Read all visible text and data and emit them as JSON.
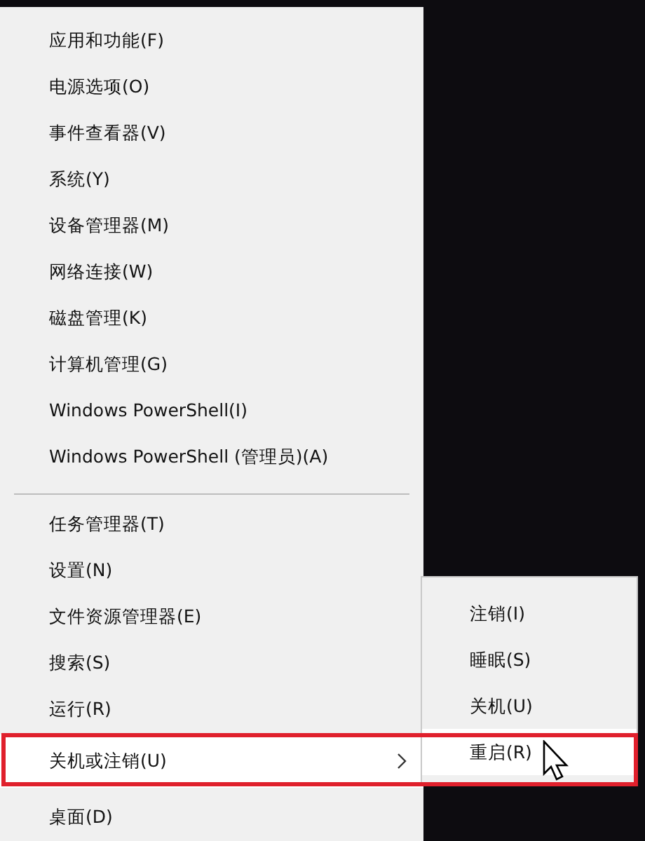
{
  "menu": {
    "groups": [
      {
        "items": [
          {
            "label": "应用和功能(F)",
            "selected": false,
            "outlined": false,
            "has_submenu": false
          },
          {
            "label": "电源选项(O)",
            "selected": false,
            "outlined": false,
            "has_submenu": false
          },
          {
            "label": "事件查看器(V)",
            "selected": false,
            "outlined": false,
            "has_submenu": false
          },
          {
            "label": "系统(Y)",
            "selected": false,
            "outlined": false,
            "has_submenu": false
          },
          {
            "label": "设备管理器(M)",
            "selected": false,
            "outlined": false,
            "has_submenu": false
          },
          {
            "label": "网络连接(W)",
            "selected": false,
            "outlined": false,
            "has_submenu": false
          },
          {
            "label": "磁盘管理(K)",
            "selected": false,
            "outlined": false,
            "has_submenu": false
          },
          {
            "label": "计算机管理(G)",
            "selected": false,
            "outlined": false,
            "has_submenu": false
          },
          {
            "label": "Windows PowerShell(I)",
            "selected": false,
            "outlined": false,
            "has_submenu": false
          },
          {
            "label": "Windows PowerShell (管理员)(A)",
            "selected": false,
            "outlined": false,
            "has_submenu": false
          }
        ]
      },
      {
        "items": [
          {
            "label": "任务管理器(T)",
            "selected": false,
            "outlined": false,
            "has_submenu": false
          },
          {
            "label": "设置(N)",
            "selected": false,
            "outlined": false,
            "has_submenu": false
          },
          {
            "label": "文件资源管理器(E)",
            "selected": false,
            "outlined": false,
            "has_submenu": false
          },
          {
            "label": "搜索(S)",
            "selected": false,
            "outlined": false,
            "has_submenu": false
          },
          {
            "label": "运行(R)",
            "selected": false,
            "outlined": false,
            "has_submenu": false
          },
          {
            "label": "关机或注销(U)",
            "selected": true,
            "outlined": true,
            "has_submenu": true
          },
          {
            "label": "桌面(D)",
            "selected": false,
            "outlined": false,
            "has_submenu": false
          }
        ]
      }
    ]
  },
  "submenu": {
    "items": [
      {
        "label": "注销(I)",
        "selected": false
      },
      {
        "label": "睡眠(S)",
        "selected": false
      },
      {
        "label": "关机(U)",
        "selected": false
      },
      {
        "label": "重启(R)",
        "selected": true
      }
    ]
  }
}
